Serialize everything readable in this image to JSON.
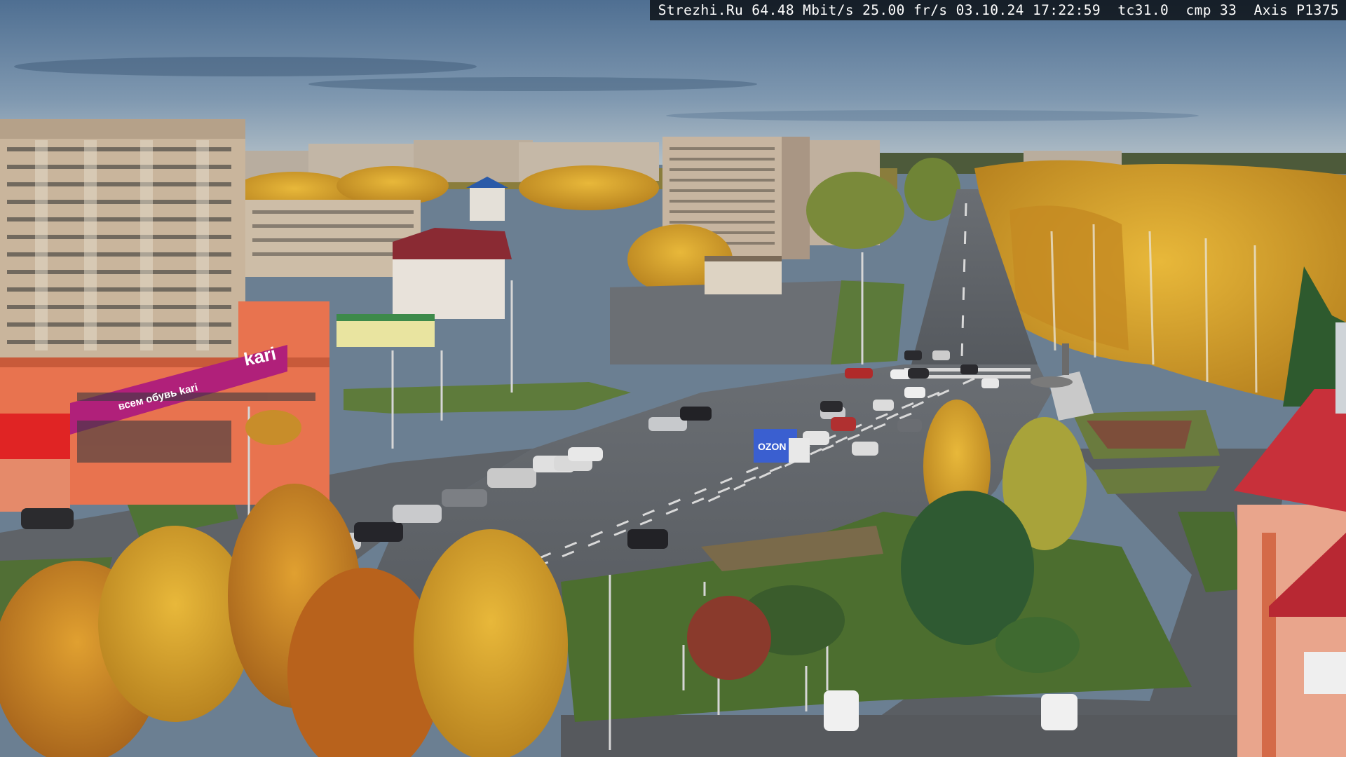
{
  "overlay": {
    "site": "Strezhi.Ru",
    "bitrate": "64.48 Mbit/s",
    "framerate": "25.00 fr/s",
    "date": "03.10.24",
    "time": "17:22:59",
    "tc": "tc31.0",
    "cmp": "cmp 33",
    "camera": "Axis P1375"
  },
  "signs": {
    "store": "kari",
    "store_banner": "всем обувь kari",
    "truck": "OZON"
  },
  "colors": {
    "sky_top": "#4f6f92",
    "sky_bottom": "#a9b8c2",
    "foliage": "#d5a22a",
    "asphalt": "#5d6166",
    "grass": "#5c7a3a",
    "store_facade": "#e8734f",
    "store_banner": "#b0207a"
  }
}
